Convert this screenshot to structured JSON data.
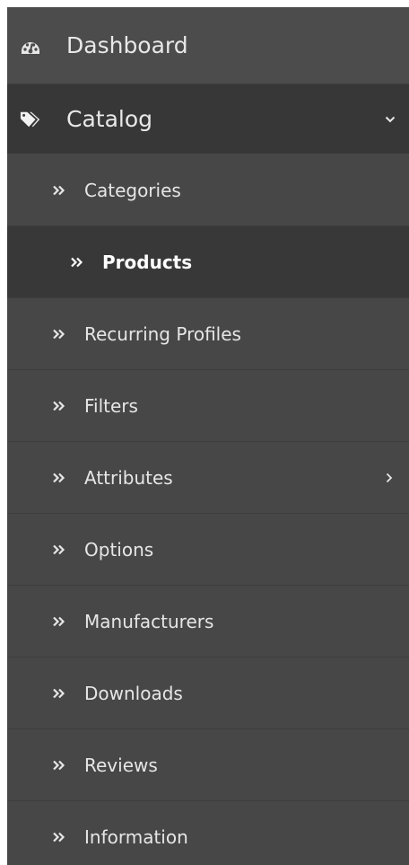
{
  "menu": {
    "dashboard": {
      "label": "Dashboard",
      "icon": "dashboard-gauge-icon"
    },
    "catalog": {
      "label": "Catalog",
      "icon": "tags-icon",
      "expanded": true
    },
    "sub_items": [
      {
        "label": "Categories",
        "active": false,
        "has_children": false
      },
      {
        "label": "Products",
        "active": true,
        "has_children": false
      },
      {
        "label": "Recurring Profiles",
        "active": false,
        "has_children": false
      },
      {
        "label": "Filters",
        "active": false,
        "has_children": false
      },
      {
        "label": "Attributes",
        "active": false,
        "has_children": true
      },
      {
        "label": "Options",
        "active": false,
        "has_children": false
      },
      {
        "label": "Manufacturers",
        "active": false,
        "has_children": false
      },
      {
        "label": "Downloads",
        "active": false,
        "has_children": false
      },
      {
        "label": "Reviews",
        "active": false,
        "has_children": false
      },
      {
        "label": "Information",
        "active": false,
        "has_children": false
      }
    ]
  },
  "colors": {
    "menu_bg": "#444444",
    "active_bg": "#383838",
    "text": "#e6e6e6"
  }
}
